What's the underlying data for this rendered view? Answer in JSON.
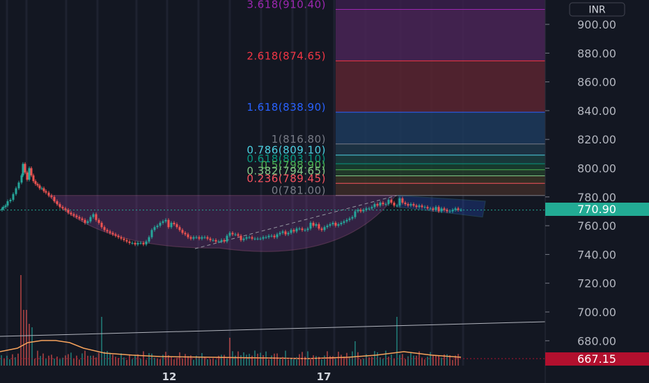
{
  "chart_data": {
    "type": "candlestick",
    "currency": "INR",
    "ylim": [
      660,
      915
    ],
    "y_ticks": [
      "900.00",
      "880.00",
      "860.00",
      "840.00",
      "820.00",
      "800.00",
      "780.00",
      "760.00",
      "740.00",
      "720.00",
      "700.00",
      "680.00"
    ],
    "x_labels": [
      "12",
      "17"
    ],
    "last_price": "770.90",
    "last_price_value": 770.9,
    "marker_label": "667.15",
    "marker_value": 667.15,
    "fib_levels": [
      {
        "label": "3.618(910.40)",
        "price": 910.4,
        "color": "#9c27b0"
      },
      {
        "label": "2.618(874.65)",
        "price": 874.65,
        "color": "#f23645"
      },
      {
        "label": "1.618(838.90)",
        "price": 838.9,
        "color": "#2962ff"
      },
      {
        "label": "1(816.80)",
        "price": 816.8,
        "color": "#787b86"
      },
      {
        "label": "0.786(809.10)",
        "price": 809.1,
        "color": "#4dd0e1"
      },
      {
        "label": "0.618(803.10)",
        "price": 803.1,
        "color": "#089981"
      },
      {
        "label": "0.5(798.90)",
        "price": 798.9,
        "color": "#4caf50"
      },
      {
        "label": "0.382(794.65)",
        "price": 794.65,
        "color": "#81c784"
      },
      {
        "label": "0.236(789.45)",
        "price": 789.45,
        "color": "#f7525f"
      },
      {
        "label": "0(781.00)",
        "price": 781.0,
        "color": "#787b86"
      }
    ],
    "cup_rim_price": 781.0,
    "cup_bottom_price": 744.5,
    "price_path": [
      [
        0,
        771
      ],
      [
        3,
        772
      ],
      [
        5,
        773
      ],
      [
        8,
        774
      ],
      [
        11,
        777
      ],
      [
        15,
        778
      ],
      [
        19,
        782
      ],
      [
        23,
        786
      ],
      [
        27,
        790
      ],
      [
        31,
        795
      ],
      [
        33,
        803
      ],
      [
        36,
        797
      ],
      [
        39,
        792
      ],
      [
        42,
        800
      ],
      [
        45,
        795
      ],
      [
        48,
        791
      ],
      [
        51,
        789
      ],
      [
        54,
        788
      ],
      [
        57,
        786
      ],
      [
        60,
        786
      ],
      [
        63,
        784
      ],
      [
        66,
        783
      ],
      [
        70,
        781
      ],
      [
        74,
        780
      ],
      [
        78,
        777
      ],
      [
        82,
        775
      ],
      [
        86,
        773
      ],
      [
        90,
        772
      ],
      [
        94,
        771
      ],
      [
        98,
        769
      ],
      [
        102,
        768
      ],
      [
        106,
        767
      ],
      [
        110,
        766
      ],
      [
        114,
        765
      ],
      [
        118,
        764
      ],
      [
        122,
        762
      ],
      [
        126,
        763
      ],
      [
        130,
        766
      ],
      [
        134,
        768
      ],
      [
        138,
        764
      ],
      [
        142,
        762
      ],
      [
        146,
        759
      ],
      [
        150,
        757
      ],
      [
        154,
        756
      ],
      [
        158,
        755
      ],
      [
        162,
        754
      ],
      [
        166,
        753
      ],
      [
        170,
        752
      ],
      [
        174,
        751
      ],
      [
        178,
        750
      ],
      [
        182,
        749
      ],
      [
        186,
        748
      ],
      [
        190,
        748
      ],
      [
        194,
        747
      ],
      [
        198,
        748
      ],
      [
        202,
        748
      ],
      [
        206,
        747
      ],
      [
        210,
        749
      ],
      [
        214,
        752
      ],
      [
        218,
        757
      ],
      [
        222,
        759
      ],
      [
        226,
        760
      ],
      [
        230,
        762
      ],
      [
        234,
        763
      ],
      [
        238,
        764
      ],
      [
        242,
        759
      ],
      [
        246,
        762
      ],
      [
        250,
        761
      ],
      [
        254,
        759
      ],
      [
        258,
        757
      ],
      [
        262,
        755
      ],
      [
        266,
        754
      ],
      [
        270,
        752
      ],
      [
        274,
        751
      ],
      [
        278,
        752
      ],
      [
        282,
        752
      ],
      [
        286,
        751
      ],
      [
        290,
        752
      ],
      [
        294,
        752
      ],
      [
        298,
        751
      ],
      [
        302,
        750
      ],
      [
        306,
        750
      ],
      [
        310,
        749
      ],
      [
        314,
        749
      ],
      [
        318,
        750
      ],
      [
        322,
        749
      ],
      [
        326,
        753
      ],
      [
        330,
        755
      ],
      [
        334,
        754
      ],
      [
        338,
        754
      ],
      [
        342,
        753
      ],
      [
        346,
        750
      ],
      [
        350,
        751
      ],
      [
        354,
        752
      ],
      [
        358,
        752
      ],
      [
        362,
        751
      ],
      [
        366,
        751
      ],
      [
        370,
        751
      ],
      [
        374,
        751
      ],
      [
        378,
        752
      ],
      [
        382,
        752
      ],
      [
        386,
        753
      ],
      [
        390,
        753
      ],
      [
        394,
        752
      ],
      [
        398,
        754
      ],
      [
        402,
        755
      ],
      [
        406,
        756
      ],
      [
        410,
        754
      ],
      [
        414,
        755
      ],
      [
        418,
        757
      ],
      [
        422,
        756
      ],
      [
        426,
        758
      ],
      [
        430,
        758
      ],
      [
        434,
        757
      ],
      [
        438,
        757
      ],
      [
        442,
        758
      ],
      [
        446,
        762
      ],
      [
        450,
        760
      ],
      [
        454,
        761
      ],
      [
        458,
        758
      ],
      [
        462,
        757
      ],
      [
        466,
        759
      ],
      [
        470,
        760
      ],
      [
        474,
        761
      ],
      [
        478,
        762
      ],
      [
        482,
        760
      ],
      [
        486,
        761
      ],
      [
        490,
        762
      ],
      [
        494,
        763
      ],
      [
        498,
        764
      ],
      [
        502,
        765
      ],
      [
        506,
        766
      ],
      [
        510,
        770
      ],
      [
        514,
        771
      ],
      [
        518,
        770
      ],
      [
        522,
        771
      ],
      [
        526,
        772
      ],
      [
        530,
        772
      ],
      [
        534,
        773
      ],
      [
        538,
        775
      ],
      [
        542,
        774
      ],
      [
        546,
        776
      ],
      [
        550,
        775
      ],
      [
        554,
        775
      ],
      [
        558,
        778
      ],
      [
        562,
        776
      ],
      [
        566,
        774
      ],
      [
        570,
        774
      ],
      [
        574,
        779
      ],
      [
        578,
        776
      ],
      [
        582,
        775
      ],
      [
        586,
        774
      ],
      [
        590,
        775
      ],
      [
        594,
        774
      ],
      [
        598,
        773
      ],
      [
        602,
        774
      ],
      [
        606,
        773
      ],
      [
        610,
        773
      ],
      [
        614,
        772
      ],
      [
        618,
        772
      ],
      [
        622,
        771
      ],
      [
        626,
        773
      ],
      [
        630,
        770
      ],
      [
        634,
        772
      ],
      [
        638,
        771
      ],
      [
        642,
        770
      ],
      [
        646,
        770
      ],
      [
        650,
        771
      ],
      [
        654,
        772
      ],
      [
        658,
        771
      ],
      [
        662,
        771
      ]
    ]
  }
}
